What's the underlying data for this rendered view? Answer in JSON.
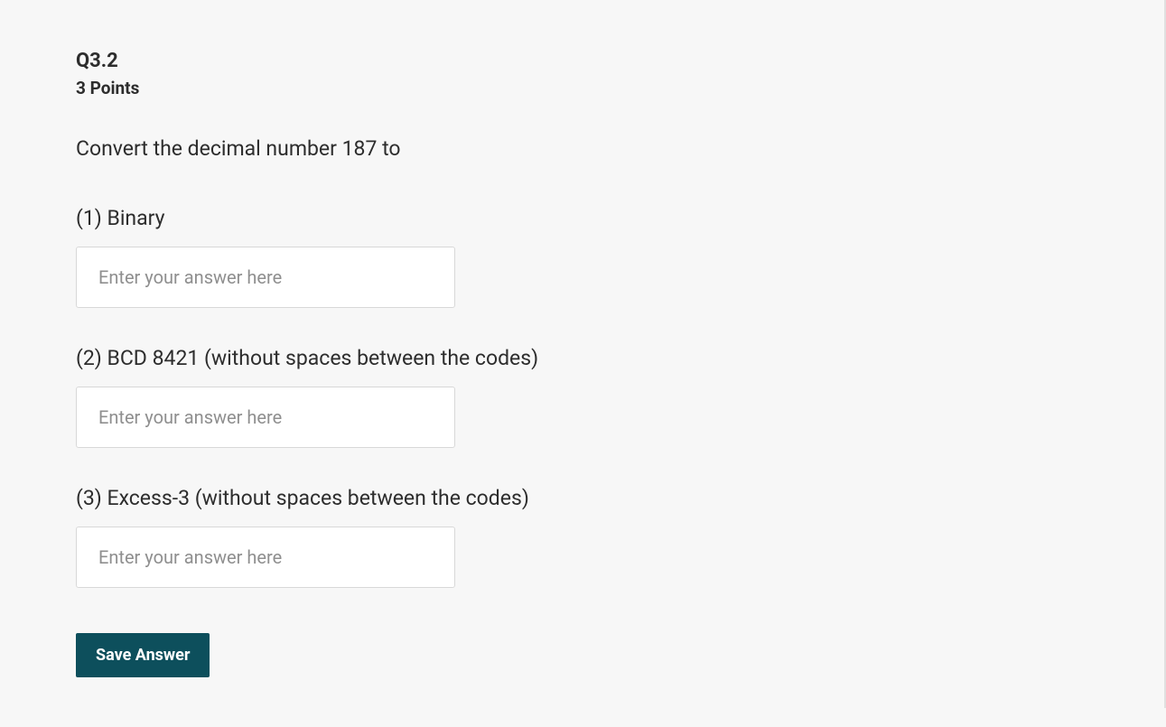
{
  "question": {
    "number": "Q3.2",
    "points": "3 Points",
    "prompt": "Convert the decimal number 187 to",
    "parts": [
      {
        "label": "(1) Binary",
        "placeholder": "Enter your answer here"
      },
      {
        "label": "(2) BCD 8421 (without spaces between the codes)",
        "placeholder": "Enter your answer here"
      },
      {
        "label": "(3) Excess-3 (without spaces between the codes)",
        "placeholder": "Enter your answer here"
      }
    ]
  },
  "buttons": {
    "save": "Save Answer"
  }
}
